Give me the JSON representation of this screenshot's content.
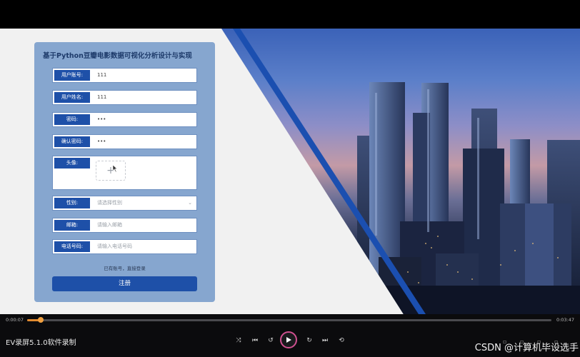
{
  "form": {
    "title": "基于Python豆瓣电影数据可视化分析设计与实现",
    "fields": [
      {
        "label": "用户账号:",
        "value": "111"
      },
      {
        "label": "用户姓名:",
        "value": "111"
      },
      {
        "label": "密码:",
        "value": "•••"
      },
      {
        "label": "确认密码:",
        "value": "•••"
      },
      {
        "label": "头像:",
        "value": ""
      },
      {
        "label": "性别:",
        "placeholder": "请选择性别"
      },
      {
        "label": "邮箱:",
        "placeholder": "请输入邮箱"
      },
      {
        "label": "电话号码:",
        "placeholder": "请输入电话号码"
      }
    ],
    "login_link": "已有账号，直接登录",
    "register_button": "注册"
  },
  "player": {
    "current_time": "0:00:07",
    "total_time": "0:03:47",
    "progress_fraction": 0.026,
    "app_name": "EV录屏5.1.0软件录制",
    "accent_color": "#e0892f"
  },
  "watermark": "CSDN @计算机毕设选手"
}
